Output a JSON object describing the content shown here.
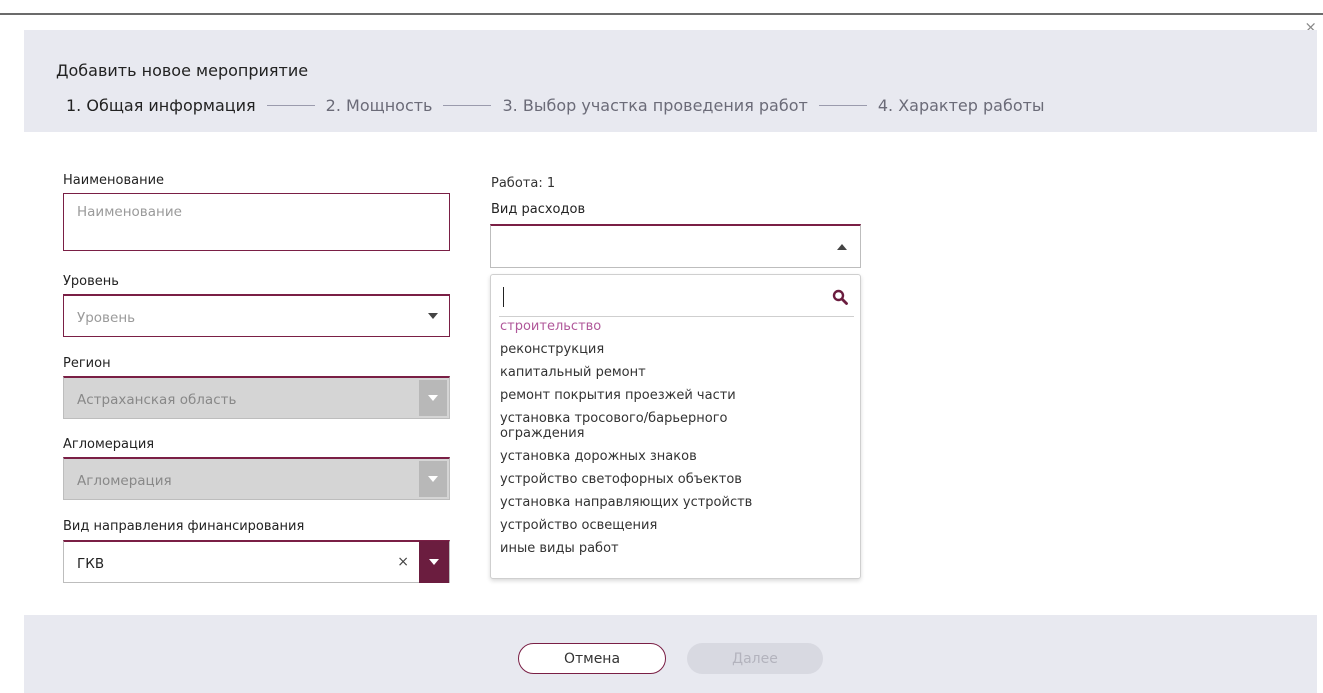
{
  "dialog": {
    "title": "Добавить новое мероприятие",
    "close_label": "×",
    "steps": [
      {
        "label": "1. Общая информация"
      },
      {
        "label": "2. Мощность"
      },
      {
        "label": "3. Выбор участка проведения работ"
      },
      {
        "label": "4. Характер работы"
      }
    ]
  },
  "form": {
    "name": {
      "label": "Наименование",
      "placeholder": "Наименование"
    },
    "level": {
      "label": "Уровень",
      "placeholder": "Уровень"
    },
    "region": {
      "label": "Регион",
      "value": "Астраханская область"
    },
    "agglomeration": {
      "label": "Агломерация",
      "placeholder": "Агломерация"
    },
    "financing": {
      "label": "Вид направления финансирования",
      "value": "ГКВ",
      "clear": "×"
    }
  },
  "work": {
    "label": "Работа: 1",
    "expense_type": {
      "label": "Вид расходов",
      "value": "",
      "options": [
        "строительство",
        "реконструкция",
        "капитальный ремонт",
        "ремонт покрытия проезжей части",
        "установка тросового/барьерного ограждения",
        "установка дорожных знаков",
        "устройство светофорных объектов",
        "установка направляющих устройств",
        "устройство освещения",
        "иные виды работ"
      ]
    }
  },
  "footer": {
    "cancel_label": "Отмена",
    "next_label": "Далее"
  },
  "colors": {
    "accent": "#6b1d3f",
    "highlight_option": "#b0589a",
    "header_bg": "#e8e9f0"
  }
}
